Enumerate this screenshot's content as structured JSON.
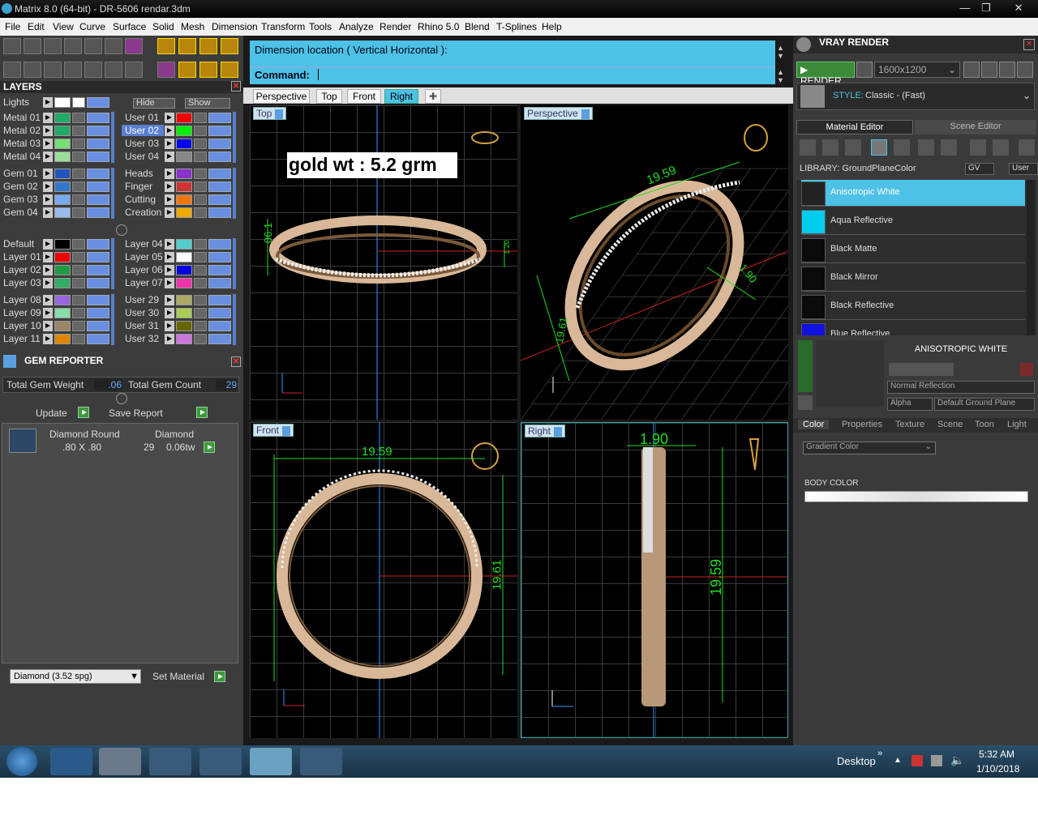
{
  "window": {
    "title": "Matrix 8.0 (64-bit) - DR-5606 rendar.3dm"
  },
  "menu": [
    "File",
    "Edit",
    "View",
    "Curve",
    "Surface",
    "Solid",
    "Mesh",
    "Dimension",
    "Transform",
    "Tools",
    "Analyze",
    "Render",
    "Rhino 5.0",
    "Blend",
    "T-Splines",
    "Help"
  ],
  "layers": {
    "title": "LAYERS",
    "lights_label": "Lights",
    "hide_label": "Hide",
    "show_label": "Show",
    "left": [
      {
        "name": "Metal 01",
        "color": "#22aa66"
      },
      {
        "name": "Metal 02",
        "color": "#22aa66"
      },
      {
        "name": "Metal 03",
        "color": "#77dd77"
      },
      {
        "name": "Metal 04",
        "color": "#99dd99"
      },
      {
        "name": "Gem 01",
        "color": "#2255bb"
      },
      {
        "name": "Gem 02",
        "color": "#3377cc"
      },
      {
        "name": "Gem 03",
        "color": "#77aaee"
      },
      {
        "name": "Gem 04",
        "color": "#99bbee"
      },
      {
        "name": "Default",
        "color": "#000000"
      },
      {
        "name": "Layer 01",
        "color": "#ee0000"
      },
      {
        "name": "Layer 02",
        "color": "#229944"
      },
      {
        "name": "Layer 03",
        "color": "#33aa66"
      },
      {
        "name": "Layer 08",
        "color": "#9966dd"
      },
      {
        "name": "Layer 09",
        "color": "#88ddaa"
      },
      {
        "name": "Layer 10",
        "color": "#998866"
      },
      {
        "name": "Layer 11",
        "color": "#dd8800"
      }
    ],
    "right": [
      {
        "name": "User 01",
        "color": "#ee0000"
      },
      {
        "name": "User 02",
        "color": "#00ee00"
      },
      {
        "name": "User 03",
        "color": "#0000ee"
      },
      {
        "name": "User 04",
        "color": "#888888"
      },
      {
        "name": "Heads",
        "color": "#8833cc"
      },
      {
        "name": "Finger",
        "color": "#cc3333"
      },
      {
        "name": "Cutting",
        "color": "#ee7711"
      },
      {
        "name": "Creation",
        "color": "#eeaa00"
      },
      {
        "name": "Layer 04",
        "color": "#55cccc"
      },
      {
        "name": "Layer 05",
        "color": "#ffffff"
      },
      {
        "name": "Layer 06",
        "color": "#0000dd"
      },
      {
        "name": "Layer 07",
        "color": "#ee33aa"
      },
      {
        "name": "User 29",
        "color": "#aaaa66"
      },
      {
        "name": "User 30",
        "color": "#aacc55"
      },
      {
        "name": "User 31",
        "color": "#666600"
      },
      {
        "name": "User 32",
        "color": "#cc77dd"
      }
    ]
  },
  "gem_reporter": {
    "title": "GEM REPORTER",
    "total_weight_label": "Total Gem Weight",
    "total_weight": ".06",
    "total_count_label": "Total Gem Count",
    "total_count": "29",
    "update_label": "Update",
    "save_label": "Save Report",
    "row": {
      "shape": "Diamond Round",
      "size": ".80 X .80",
      "material": "Diamond",
      "count": "29",
      "weight": "0.06tw"
    },
    "material_select": "Diamond    (3.52 spg)",
    "set_material_label": "Set Material"
  },
  "command": {
    "prompt": "Dimension location ( Vertical  Horizontal ):",
    "label": "Command:"
  },
  "view_tabs": [
    "Perspective",
    "Top",
    "Front",
    "Right"
  ],
  "viewports": {
    "top": {
      "label": "Top",
      "note": "gold wt : 5.2 grm",
      "dim_a": "06.1",
      "dim_b": "1.20"
    },
    "perspective": {
      "label": "Perspective",
      "dim_a": "19.59",
      "dim_b": "1.90",
      "dim_c": "19.61"
    },
    "front": {
      "label": "Front",
      "dim_w": "19.59",
      "dim_h": "19.61"
    },
    "right": {
      "label": "Right",
      "dim_w": "1.90",
      "dim_h": "19.59"
    }
  },
  "vray": {
    "title": "VRAY RENDER",
    "render_label": "RENDER",
    "resolution": "1600x1200",
    "style_label": "STYLE:",
    "style_value": "Classic - (Fast)",
    "tabs": [
      "Material Editor",
      "Scene Editor"
    ],
    "library_label": "LIBRARY: GroundPlaneColor",
    "gv": "GV",
    "user": "User",
    "materials": [
      {
        "name": "Anisotropic White",
        "color": "#222222"
      },
      {
        "name": "Aqua Reflective",
        "color": "#00ccee"
      },
      {
        "name": "Black Matte",
        "color": "#0a0a0a"
      },
      {
        "name": "Black Mirror",
        "color": "#0a0a0a"
      },
      {
        "name": "Black Reflective",
        "color": "#0a0a0a"
      },
      {
        "name": "Blue Reflective",
        "color": "#1111dd"
      }
    ],
    "selected_name": "ANISOTROPIC WHITE",
    "reflection": "Normal Reflection",
    "alpha": "Alpha",
    "ground": "Default Ground Plane",
    "prop_tabs": [
      "Color",
      "Properties",
      "Texture",
      "Scene",
      "Toon",
      "Light"
    ],
    "color_mode": "Gradient Color",
    "body_color": "BODY COLOR"
  },
  "taskbar": {
    "desktop": "Desktop",
    "time": "5:32 AM",
    "date": "1/10/2018"
  }
}
